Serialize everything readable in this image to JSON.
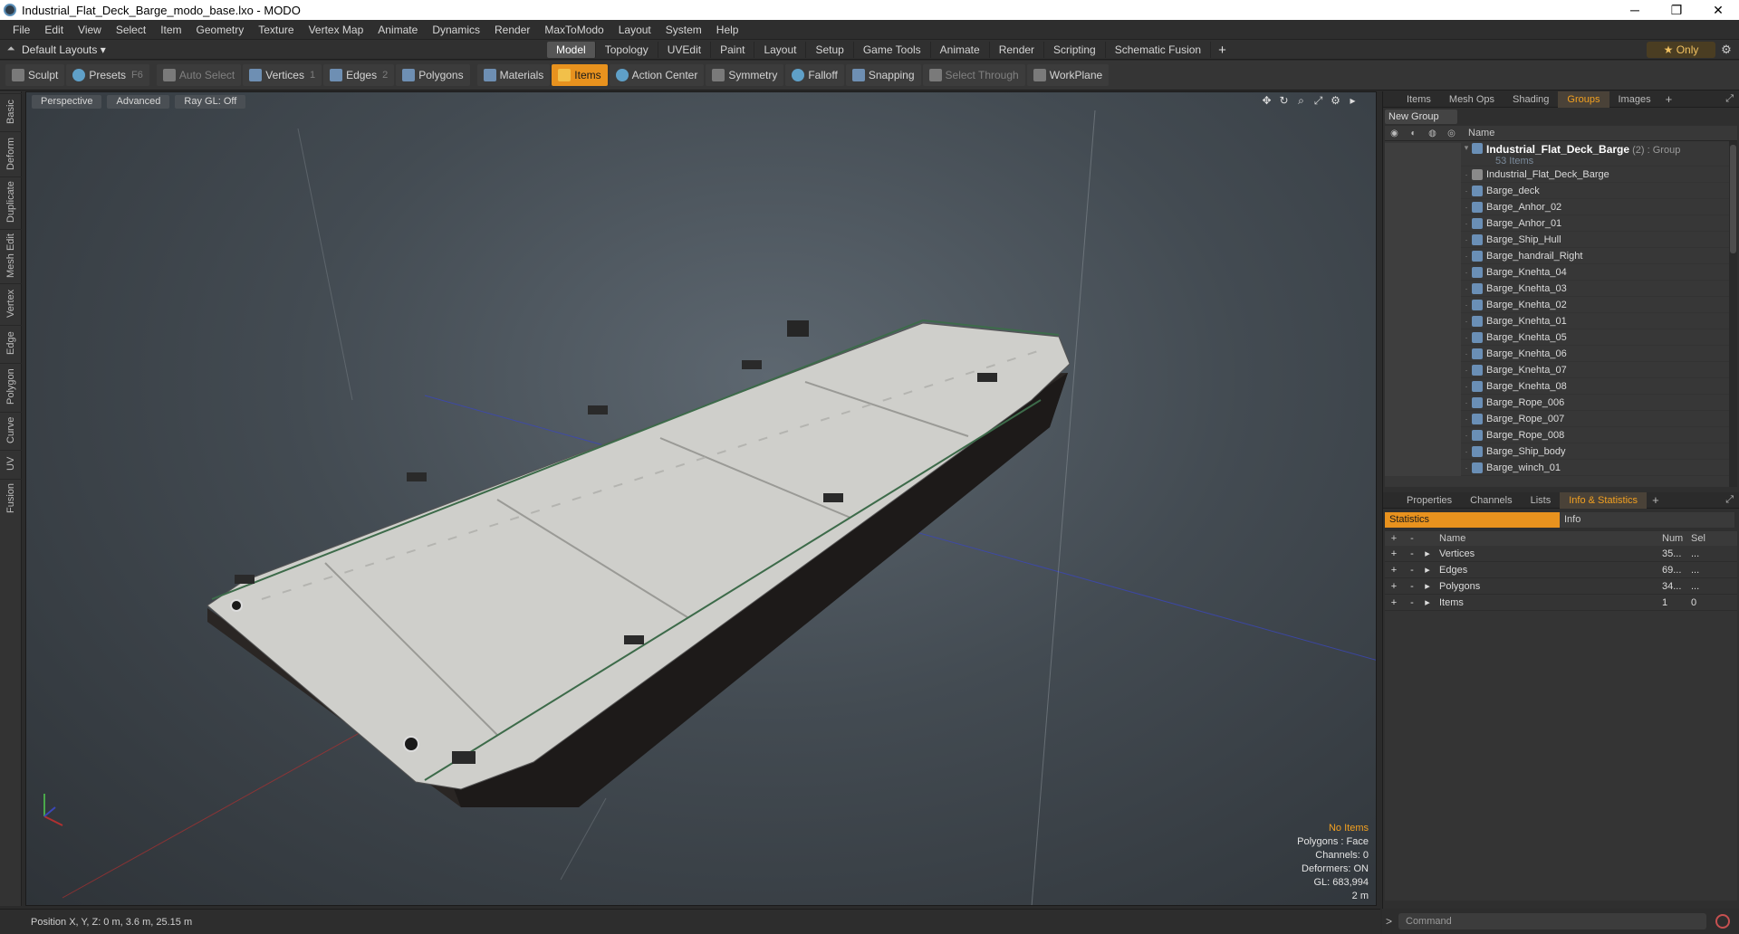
{
  "window": {
    "title": "Industrial_Flat_Deck_Barge_modo_base.lxo - MODO",
    "minimize": "─",
    "maximize": "❐",
    "close": "✕"
  },
  "menu": [
    "File",
    "Edit",
    "View",
    "Select",
    "Item",
    "Geometry",
    "Texture",
    "Vertex Map",
    "Animate",
    "Dynamics",
    "Render",
    "MaxToModo",
    "Layout",
    "System",
    "Help"
  ],
  "layout": {
    "dropdown": "Default Layouts ▾",
    "tabs": [
      "Model",
      "Topology",
      "UVEdit",
      "Paint",
      "Layout",
      "Setup",
      "Game Tools",
      "Animate",
      "Render",
      "Scripting",
      "Schematic Fusion"
    ],
    "active_tab": "Model",
    "only_label": "★  Only"
  },
  "toolbar": {
    "sculpt": "Sculpt",
    "presets": "Presets",
    "presets_key": "F6",
    "auto_select": "Auto Select",
    "vertices": "Vertices",
    "vertices_key": "1",
    "edges": "Edges",
    "edges_key": "2",
    "polygons": "Polygons",
    "materials": "Materials",
    "items": "Items",
    "action_center": "Action Center",
    "symmetry": "Symmetry",
    "falloff": "Falloff",
    "snapping": "Snapping",
    "select_through": "Select Through",
    "workplane": "WorkPlane"
  },
  "left_tabs": [
    "Basic",
    "Deform",
    "Duplicate",
    "Mesh Edit",
    "Vertex",
    "Edge",
    "Polygon",
    "Curve",
    "UV",
    "Fusion"
  ],
  "viewport": {
    "perspective": "Perspective",
    "advanced": "Advanced",
    "raygl": "Ray GL: Off",
    "info": {
      "no_items": "No Items",
      "polygons": "Polygons : Face",
      "channels": "Channels: 0",
      "deformers": "Deformers: ON",
      "gl": "GL: 683,994",
      "scale": "2 m"
    }
  },
  "status": {
    "position": "Position X, Y, Z:   0 m, 3.6 m, 25.15 m"
  },
  "groups_panel": {
    "tabs": [
      "Items",
      "Mesh Ops",
      "Shading",
      "Groups",
      "Images"
    ],
    "active_tab": "Groups",
    "new_group": "New Group",
    "name_header": "Name",
    "group_name": "Industrial_Flat_Deck_Barge",
    "group_suffix": "(2) : Group",
    "group_count": "53 Items",
    "items": [
      "Industrial_Flat_Deck_Barge",
      "Barge_deck",
      "Barge_Anhor_02",
      "Barge_Anhor_01",
      "Barge_Ship_Hull",
      "Barge_handrail_Right",
      "Barge_Knehta_04",
      "Barge_Knehta_03",
      "Barge_Knehta_02",
      "Barge_Knehta_01",
      "Barge_Knehta_05",
      "Barge_Knehta_06",
      "Barge_Knehta_07",
      "Barge_Knehta_08",
      "Barge_Rope_006",
      "Barge_Rope_007",
      "Barge_Rope_008",
      "Barge_Ship_body",
      "Barge_winch_01"
    ]
  },
  "stats_panel": {
    "tabs": [
      "Properties",
      "Channels",
      "Lists",
      "Info & Statistics"
    ],
    "active_tab": "Info & Statistics",
    "subtabs": [
      "Statistics",
      "Info"
    ],
    "headers": {
      "name": "Name",
      "num": "Num",
      "sel": "Sel"
    },
    "rows": [
      {
        "name": "Vertices",
        "num": "35...",
        "sel": "..."
      },
      {
        "name": "Edges",
        "num": "69...",
        "sel": "..."
      },
      {
        "name": "Polygons",
        "num": "34...",
        "sel": "..."
      },
      {
        "name": "Items",
        "num": "1",
        "sel": "0"
      }
    ]
  },
  "command": {
    "prompt": ">",
    "placeholder": "Command"
  }
}
